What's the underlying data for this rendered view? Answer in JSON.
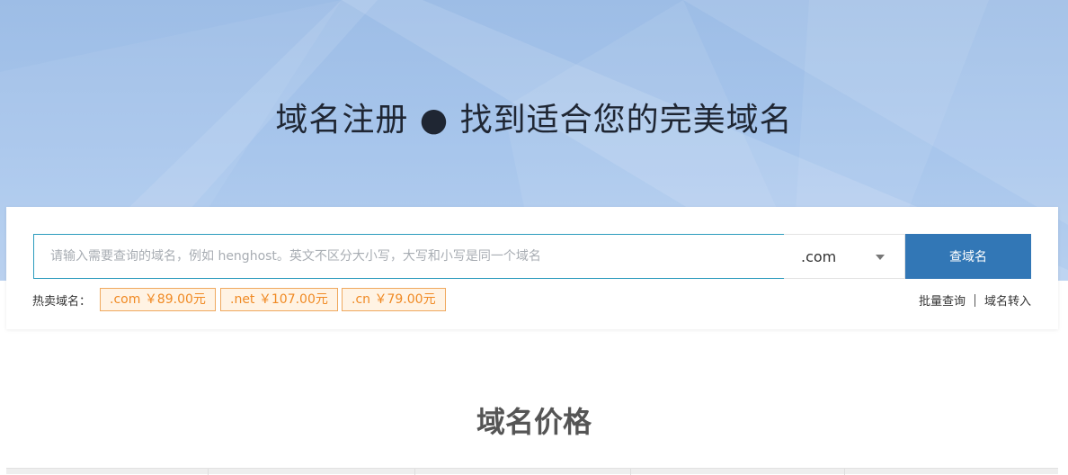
{
  "hero": {
    "title": "域名注册 ● 找到适合您的完美域名"
  },
  "search": {
    "placeholder": "请输入需要查询的域名，例如 henghost。英文不区分大小写，大写和小写是同一个域名",
    "tld_selected": ".com",
    "button_label": "查域名"
  },
  "hot": {
    "label": "热卖域名：",
    "tags": [
      {
        "tld": ".com",
        "price": "￥89.00元"
      },
      {
        "tld": ".net",
        "price": "￥107.00元"
      },
      {
        "tld": ".cn",
        "price": "￥79.00元"
      }
    ]
  },
  "links": {
    "bulk": "批量查询",
    "transfer": "域名转入"
  },
  "section": {
    "title": "域名价格"
  },
  "colors": {
    "accent": "#3277b6",
    "tag_border": "#f0a95f",
    "tag_text": "#f08a24"
  }
}
